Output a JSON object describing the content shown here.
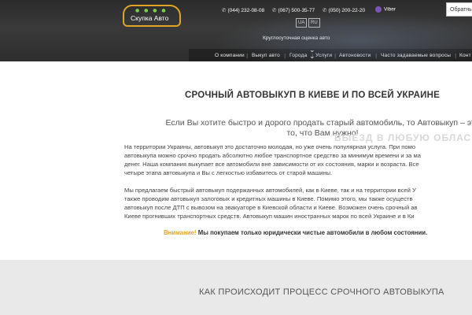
{
  "header": {
    "logo_text": "Скупка Авто",
    "phones": [
      "(044) 232-08-08",
      "(067) 500-35-77",
      "(050) 200-22-20"
    ],
    "viber": "Viber",
    "callback": "Обратны",
    "languages": [
      "UA",
      "RU"
    ],
    "tagline": "Круглосуточная оценка авто",
    "nav": [
      "О компании",
      "Выкуп авто",
      "Города",
      "Услуги",
      "Автоновости",
      "Часто задаваемые вопросы",
      "Конт"
    ]
  },
  "main": {
    "title": "СРОЧНЫЙ АВТОВЫКУП В КИЕВЕ И ПО ВСЕЙ УКРАИНЕ",
    "lead_line1": "Если Вы хотите быстро и дорого продать старый автомобиль, то Автовыкуп – это",
    "lead_line2": "то, что Вам нужно!",
    "watermark": "ВЫЕЗД В ЛЮБУЮ ОБЛАС",
    "para1_lines": [
      "На территории Украины, автовыкуп это достаточно молодая, но уже очень популярная услуга. При помо",
      "автовыкупа можно срочно продать абсолютно любое транспортное средство за минимум времени и за ма",
      "денег. Наша компания выкупает все автомобили вне зависимости от их состояния, марки и возраста. Все",
      "четыре этапа автовыкупа и Вы с легкостью избавитесь от старой машины."
    ],
    "para2_lines": [
      "Мы предлагаем быстрый автовыкуп подержанных автомобилей, как в Киеве, так и на территории всей У",
      "также проводим автовыкуп залоговых и кредитных машины в Киеве. Помимо этого, мы также осуществ",
      "автовыкуп после ДТП с вывозом на эвакуаторе в Киевской области и Киеве. Возможен очень срочный ав",
      "Киеве прогнивших транспортных средств. Автовыкуп машин иностранных марок по всей Украине и в Ки"
    ],
    "note_label": "Внимание!",
    "note_text": " Мы покупаем только юридически чистые автомобили в любом состоянии."
  },
  "section2": {
    "title": "КАК ПРОИСХОДИТ ПРОЦЕСС СРОЧНОГО АВТОВЫКУПА"
  },
  "colors": {
    "accent": "#e0a526",
    "header_bg": "#333333",
    "band_bg": "#e9e9e9",
    "viber": "#7a56b8"
  }
}
